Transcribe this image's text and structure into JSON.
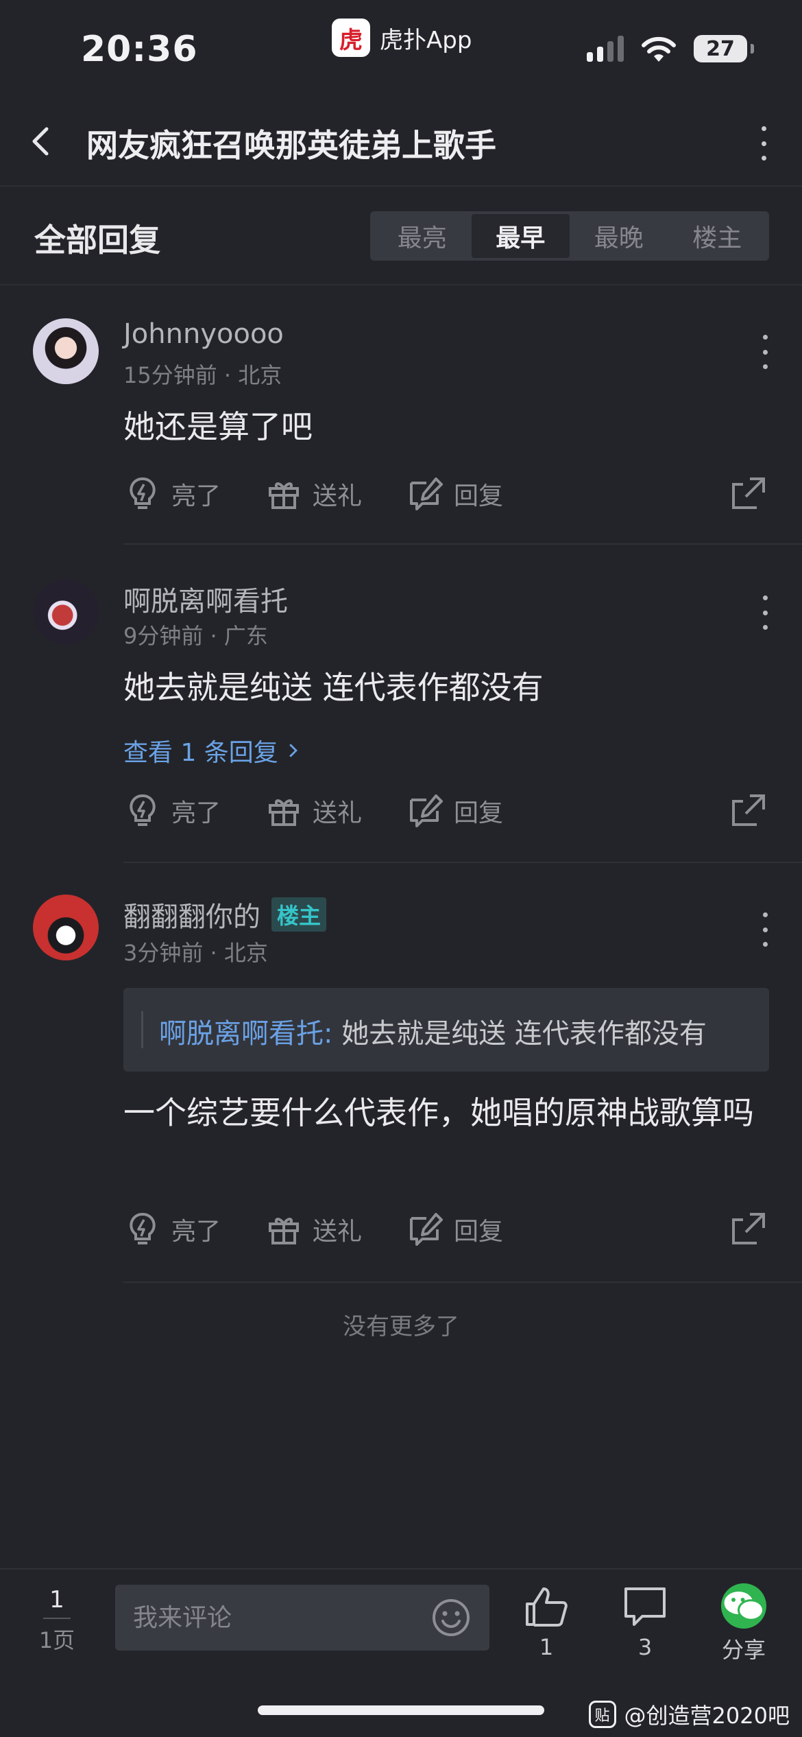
{
  "status_bar": {
    "time": "20:36",
    "app_logo_text": "虎",
    "app_name": "虎扑App",
    "battery": "27"
  },
  "nav": {
    "title": "网友疯狂召唤那英徒弟上歌手",
    "back_icon": "chevron-left-icon",
    "more_icon": "more-vertical-icon"
  },
  "replies": {
    "title": "全部回复",
    "sort_tabs": [
      "最亮",
      "最早",
      "最晚",
      "楼主"
    ],
    "active_tab": "最早"
  },
  "actions": {
    "light": "亮了",
    "gift": "送礼",
    "reply": "回复"
  },
  "comments": [
    {
      "name": "Johnnyoooo",
      "meta": "15分钟前 · 北京",
      "text": "她还是算了吧"
    },
    {
      "name": "啊脱离啊看托",
      "meta": "9分钟前 · 广东",
      "text": "她去就是纯送 连代表作都没有",
      "link": "查看 1 条回复"
    },
    {
      "name": "翻翻翻你的",
      "badge": "楼主",
      "meta": "3分钟前 · 北京",
      "quote_user": "啊脱离啊看托:",
      "quote_text": " 她去就是纯送 连代表作都没有",
      "text": "一个综艺要什么代表作，她唱的原神战歌算吗"
    }
  ],
  "footer_note": "没有更多了",
  "bottom_bar": {
    "page": "1",
    "page_total": "1页",
    "comment_placeholder": "我来评论",
    "like_count": "1",
    "comment_count": "3",
    "share_label": "分享"
  },
  "watermark": {
    "logo_text": "贴",
    "text": "@创造营2020吧"
  },
  "colors": {
    "background": "#232429",
    "link": "#6aa2e6",
    "op_badge": "#35c5c9",
    "wechat": "#2fb44f"
  }
}
